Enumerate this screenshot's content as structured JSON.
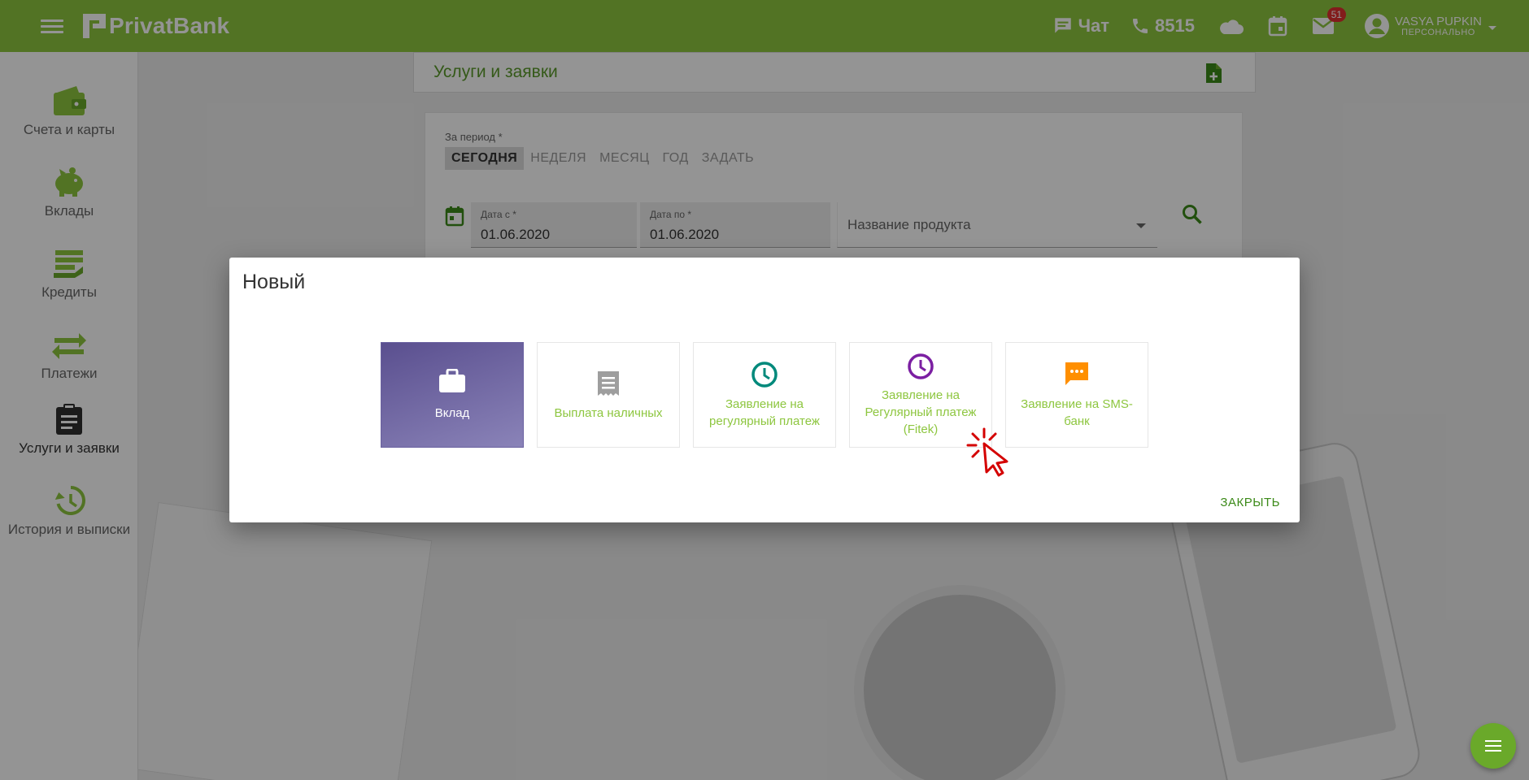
{
  "topbar": {
    "brand": "PrivatBank",
    "chat_label": "Чат",
    "phone_number": "8515",
    "mail_badge": "51",
    "user_name": "VASYA PUPKIN",
    "user_role": "ПЕРСОНАЛЬНО"
  },
  "sidebar": {
    "items": [
      {
        "label": "Счета и карты",
        "icon": "wallet-icon"
      },
      {
        "label": "Вклады",
        "icon": "piggy-bank-icon"
      },
      {
        "label": "Кредиты",
        "icon": "credit-icon"
      },
      {
        "label": "Платежи",
        "icon": "transfer-icon"
      },
      {
        "label": "Услуги и заявки",
        "icon": "clipboard-icon",
        "active": true
      },
      {
        "label": "История и выписки",
        "icon": "history-icon"
      }
    ]
  },
  "services": {
    "title": "Услуги и заявки"
  },
  "filter": {
    "period_label": "За период *",
    "periods": [
      "СЕГОДНЯ",
      "НЕДЕЛЯ",
      "МЕСЯЦ",
      "ГОД",
      "ЗАДАТЬ"
    ],
    "active_period": "СЕГОДНЯ",
    "date_from_label": "Дата с *",
    "date_from": "01.06.2020",
    "date_to_label": "Дата по *",
    "date_to": "01.06.2020",
    "product_placeholder": "Название продукта"
  },
  "modal": {
    "title": "Новый",
    "tiles": [
      {
        "label": "Вклад",
        "icon": "briefcase-icon",
        "selected": true
      },
      {
        "label": "Выплата наличных",
        "icon": "receipt-icon"
      },
      {
        "label": "Заявление на регулярный платеж",
        "icon": "clock-icon"
      },
      {
        "label": "Заявление на Регулярный платеж (Fitek)",
        "icon": "clock-icon"
      },
      {
        "label": "Заявление на SMS-банк",
        "icon": "sms-icon"
      }
    ],
    "close_label": "ЗАКРЫТЬ"
  },
  "colors": {
    "brand_green": "#8dc63f",
    "dark_green": "#3c8a19",
    "tile_selected": "#5a4f8f",
    "teal_icon": "#00897b",
    "purple_icon": "#7b1fa2",
    "orange_icon": "#ff8f00",
    "badge_red": "#e0312f"
  }
}
